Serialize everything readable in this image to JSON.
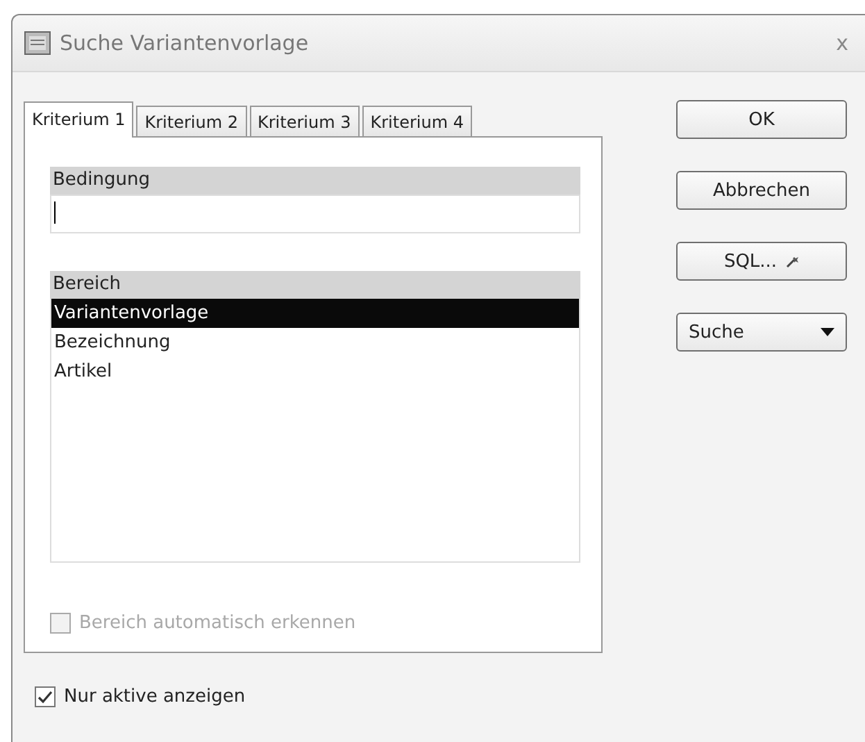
{
  "window": {
    "title": "Suche Variantenvorlage",
    "close": "x"
  },
  "tabs": [
    {
      "label": "Kriterium 1",
      "selected": true
    },
    {
      "label": "Kriterium 2",
      "selected": false
    },
    {
      "label": "Kriterium 3",
      "selected": false
    },
    {
      "label": "Kriterium 4",
      "selected": false
    }
  ],
  "condition": {
    "label": "Bedingung"
  },
  "range": {
    "label": "Bereich",
    "items": [
      {
        "label": "Variantenvorlage",
        "selected": true
      },
      {
        "label": "Bezeichnung",
        "selected": false
      },
      {
        "label": "Artikel",
        "selected": false
      }
    ]
  },
  "auto_detect": {
    "label": "Bereich automatisch erkennen",
    "checked": false,
    "disabled": true
  },
  "only_active": {
    "label": "Nur aktive anzeigen",
    "checked": true,
    "disabled": false
  },
  "buttons": [
    {
      "label": "OK",
      "kind": "push"
    },
    {
      "label": "Abbrechen",
      "kind": "push"
    },
    {
      "label": "SQL...",
      "kind": "icon"
    },
    {
      "label": "Suche",
      "kind": "dropdown"
    }
  ]
}
